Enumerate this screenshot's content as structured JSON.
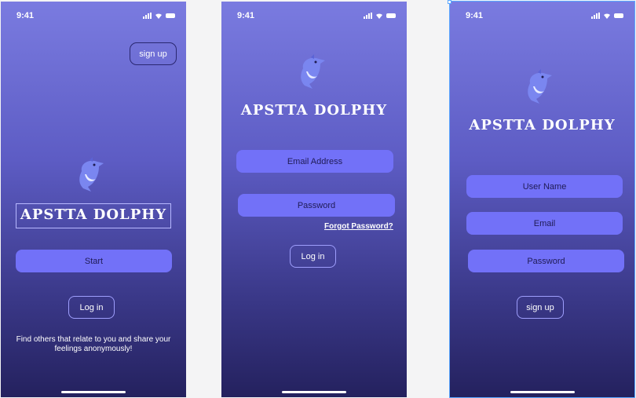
{
  "screens": [
    {
      "status": {
        "time": "9:41"
      },
      "signup_label": "sign up",
      "app_title": "APSTTA DOLPHY",
      "start_label": "Start",
      "login_label": "Log in",
      "tagline": "Find others that relate to you and share your feelings anonymously!"
    },
    {
      "status": {
        "time": "9:41"
      },
      "app_title": "APSTTA DOLPHY",
      "email_placeholder": "Email Address",
      "password_placeholder": "Password",
      "forgot_label": "Forgot Password?",
      "login_label": "Log in"
    },
    {
      "status": {
        "time": "9:41"
      },
      "app_title": "APSTTA DOLPHY",
      "username_placeholder": "User Name",
      "email_placeholder": "Email",
      "password_placeholder": "Password",
      "signup_label": "sign up"
    }
  ],
  "colors": {
    "bg_top": "#7a7be0",
    "bg_bottom": "#24215e",
    "accent": "#7271f8",
    "outline": "#9e9efc"
  },
  "icons": {
    "logo": "dolphin-icon"
  }
}
